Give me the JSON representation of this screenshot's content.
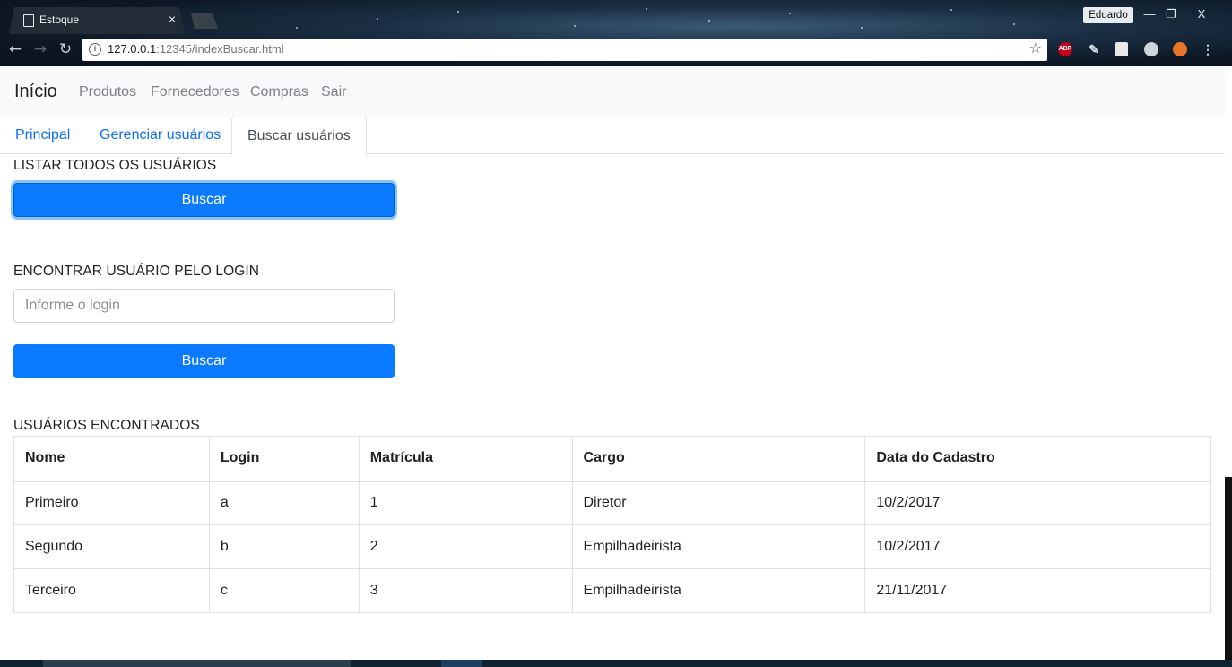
{
  "browser": {
    "tab_title": "Estoque",
    "tab_close": "×",
    "profile_name": "Eduardo",
    "window_controls": {
      "minimize": "—",
      "restore": "❐",
      "close": "X"
    },
    "url_host": "127.0.0.1",
    "url_rest": ":12345/indexBuscar.html",
    "extensions": [
      {
        "name": "adblock-plus-icon",
        "label": "ABP",
        "color": "#c5001b"
      },
      {
        "name": "pen-extension-icon",
        "label": "",
        "color": "#3a4652"
      },
      {
        "name": "reader-extension-icon",
        "label": "",
        "color": "#4a4f55"
      },
      {
        "name": "circle-extension-icon",
        "label": "",
        "color": "#cfd4d8"
      },
      {
        "name": "orange-extension-icon",
        "label": "",
        "color": "#e8742a"
      }
    ]
  },
  "navbar": {
    "brand": "Início",
    "links": [
      "Produtos",
      "Fornecedores",
      "Compras",
      "Sair"
    ]
  },
  "tabs": {
    "items": [
      "Principal",
      "Gerenciar usuários",
      "Buscar usuários"
    ],
    "active": "Buscar usuários"
  },
  "list_all": {
    "heading": "LISTAR TODOS OS USUÁRIOS",
    "button_label": "Buscar"
  },
  "find_by_login": {
    "heading": "ENCONTRAR USUÁRIO PELO LOGIN",
    "input_placeholder": "Informe o login",
    "input_value": "",
    "button_label": "Buscar"
  },
  "results": {
    "heading": "USUÁRIOS ENCONTRADOS",
    "columns": [
      "Nome",
      "Login",
      "Matrícula",
      "Cargo",
      "Data do Cadastro"
    ],
    "rows": [
      [
        "Primeiro",
        "a",
        "1",
        "Diretor",
        "10/2/2017"
      ],
      [
        "Segundo",
        "b",
        "2",
        "Empilhadeirista",
        "10/2/2017"
      ],
      [
        "Terceiro",
        "c",
        "3",
        "Empilhadeirista",
        "21/11/2017"
      ]
    ]
  },
  "colors": {
    "primary": "#0a7bff",
    "link": "#0d6efd",
    "navbar_bg": "#f8f9fa"
  }
}
